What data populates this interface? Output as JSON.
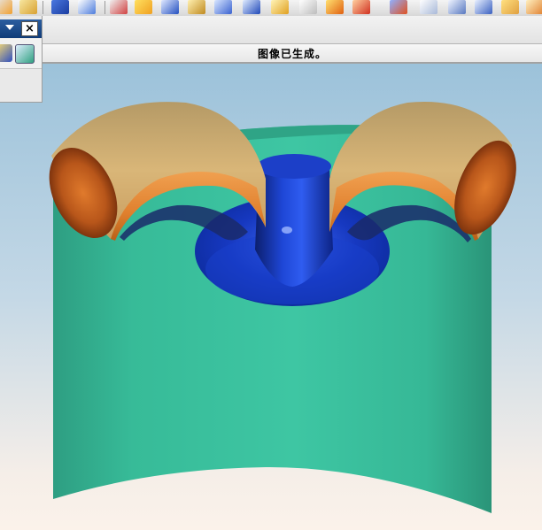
{
  "status": {
    "message": "图像已生成。"
  },
  "panel": {
    "menu_icon": "chevron-down-icon",
    "close_icon": "close-icon",
    "tools": [
      "measure-tool-icon",
      "view-tool-icon"
    ]
  },
  "toolbar": {
    "icons": [
      "part-icon",
      "sketch-icon",
      "add-icon",
      "plane-icon",
      "revolve-icon",
      "box-icon",
      "cylinder-icon",
      "pattern-icon",
      "extrude-icon",
      "edit-icon",
      "blend-icon",
      "shell-icon",
      "chamfer-icon",
      "render-icon",
      "view-icon",
      "layer-icon",
      "shade-icon",
      "wireframe-icon"
    ]
  },
  "colors": {
    "body": "#38c3a0",
    "body_shadow": "#2a9c80",
    "port_outer": "#c9a468",
    "port_inner": "#e8873a",
    "bowl": "#1236b8",
    "bowl_highlight": "#4a74ff",
    "status_text": "#000000"
  }
}
